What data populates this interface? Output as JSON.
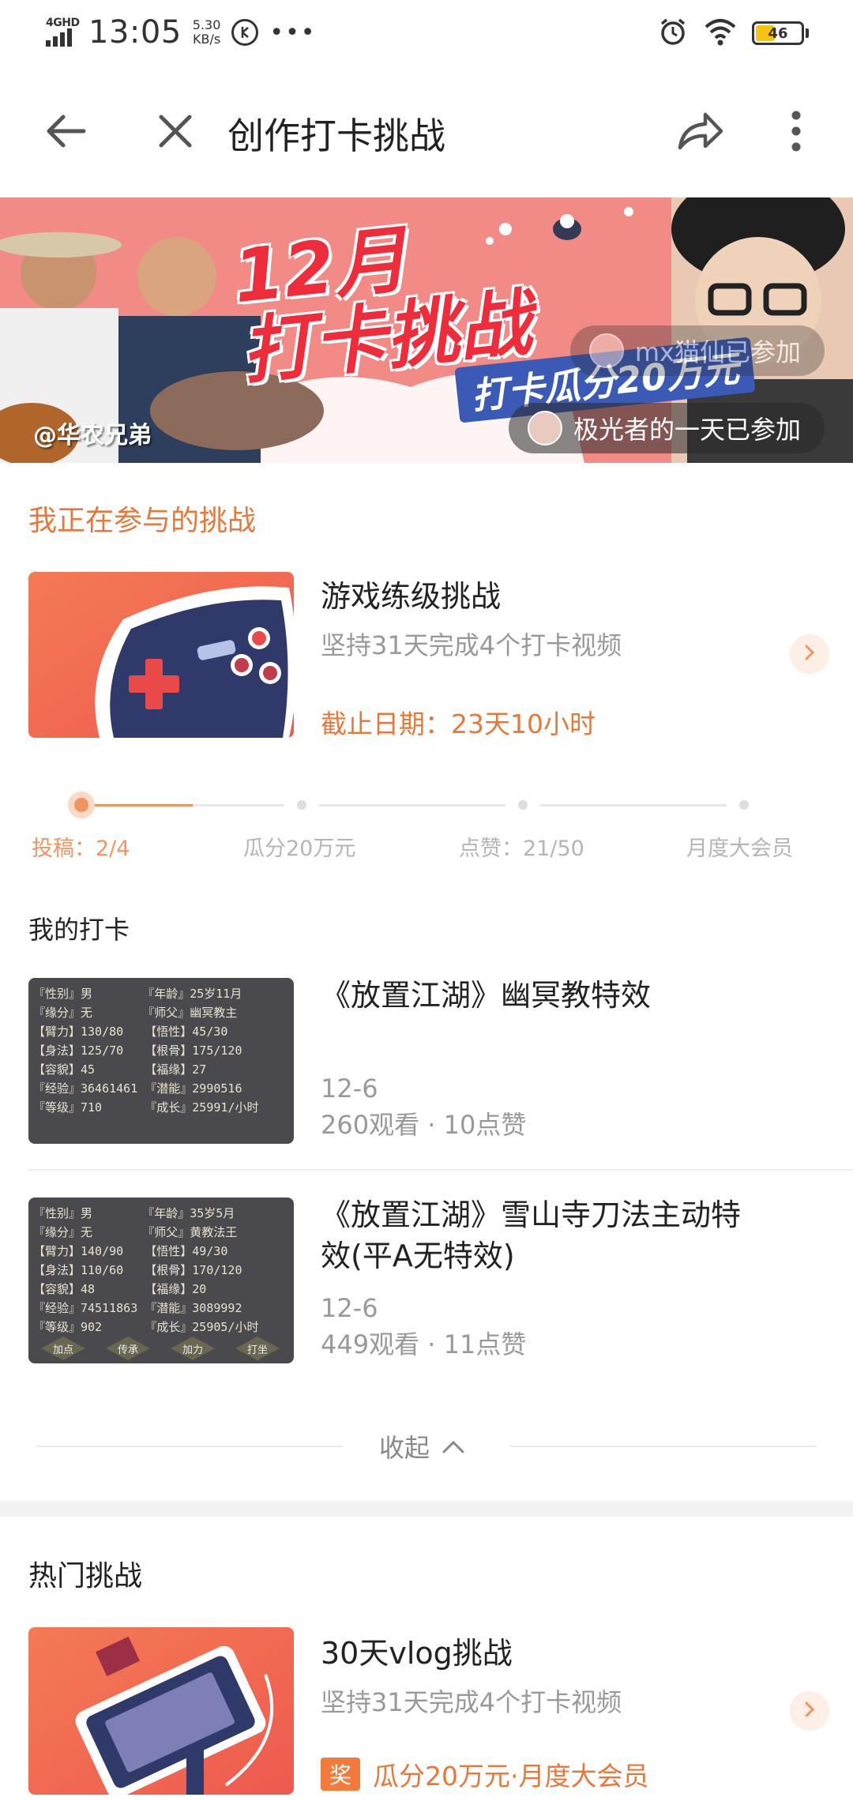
{
  "status_bar": {
    "network": "4GHD",
    "time": "13:05",
    "speed_value": "5.30",
    "speed_unit": "KB/s",
    "circle_glyph": "卡",
    "dots": "•••",
    "battery": "46",
    "battery_level": 0.46,
    "icons": [
      "signal-icon",
      "alarm-icon",
      "wifi-icon",
      "battery-icon"
    ]
  },
  "header": {
    "title": "创作打卡挑战",
    "icons": [
      "back-arrow-icon",
      "close-icon",
      "share-icon",
      "more-vertical-icon"
    ]
  },
  "banner": {
    "title_line1": "12月",
    "title_line2": "打卡挑战",
    "subtitle": "打卡瓜分20万元",
    "credit": "@华农兄弟",
    "toasts": [
      "mx猫仙已参加",
      "极光者的一天已参加"
    ],
    "bg_color": "#f28a86"
  },
  "my_challenges": {
    "heading": "我正在参与的挑战",
    "card": {
      "title": "游戏练级挑战",
      "description": "坚持31天完成4个打卡视频",
      "deadline": "截止日期：23天10小时",
      "thumb_icon": "gamepad-icon"
    },
    "progress": {
      "steps": [
        "投稿：2/4",
        "瓜分20万元",
        "点赞：21/50",
        "月度大会员"
      ],
      "active_index": 0,
      "fraction": 0.5
    }
  },
  "my_checkins": {
    "heading": "我的打卡",
    "items": [
      {
        "title": "《放置江湖》幽冥教特效",
        "date": "12-6",
        "stats": "260观看 · 10点赞",
        "thumb_text": "『性别』男       『年龄』25岁11月\n『缘分』无       『师父』幽冥教主\n【臂力】130/80   【悟性】45/30\n【身法】125/70   【根骨】175/120\n【容貌】45       【福缘】27\n『经验』36461461 『潜能』2990516\n『等级』710      『成长』25991/小时"
      },
      {
        "title": "《放置江湖》雪山寺刀法主动特效(平A无特效)",
        "date": "12-6",
        "stats": "449观看 · 11点赞",
        "thumb_text": "『性别』男       『年龄』35岁5月\n『缘分』无       『师父』黄教法王\n【臂力】140/90   【悟性】49/30\n【身法】110/60   【根骨】170/120\n【容貌】48       【福缘】20\n『经验』74511863 『潜能』3089992\n『等级』902      『成长』25905/小时"
      }
    ],
    "thumb_buttons": [
      "加点",
      "传承",
      "加力",
      "打坐"
    ],
    "collapse_label": "收起"
  },
  "hot_challenges": {
    "heading": "热门挑战",
    "card": {
      "title": "30天vlog挑战",
      "description": "坚持31天完成4个打卡视频",
      "reward_badge": "奖",
      "reward": "瓜分20万元·月度大会员",
      "thumb_icon": "phone-selfie-icon"
    }
  },
  "colors": {
    "accent": "#e8783a",
    "progress": "#f09560",
    "muted": "#999999"
  }
}
